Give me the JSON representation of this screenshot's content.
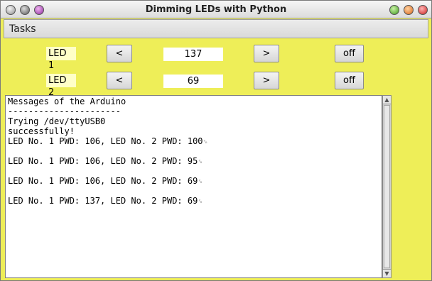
{
  "window": {
    "title": "Dimming LEDs with Python"
  },
  "menu": {
    "tasks": "Tasks"
  },
  "leds": [
    {
      "label": "LED 1",
      "dec": "<",
      "value": "137",
      "inc": ">",
      "toggle": "off"
    },
    {
      "label": "LED 2",
      "dec": "<",
      "value": "69",
      "inc": ">",
      "toggle": "off"
    }
  ],
  "log": {
    "lines": [
      "Messages of the Arduino",
      "----------------------",
      "Trying /dev/ttyUSB0",
      "successfully!",
      "LED No. 1 PWD: 106, LED No. 2 PWD: 100",
      "",
      "LED No. 1 PWD: 106, LED No. 2 PWD: 95",
      "",
      "LED No. 1 PWD: 106, LED No. 2 PWD: 69",
      "",
      "LED No. 1 PWD: 137, LED No. 2 PWD: 69"
    ],
    "cr_mark": "␍"
  },
  "colors": {
    "panel_bg": "#eeee58",
    "label_bg": "#ffffc8"
  }
}
